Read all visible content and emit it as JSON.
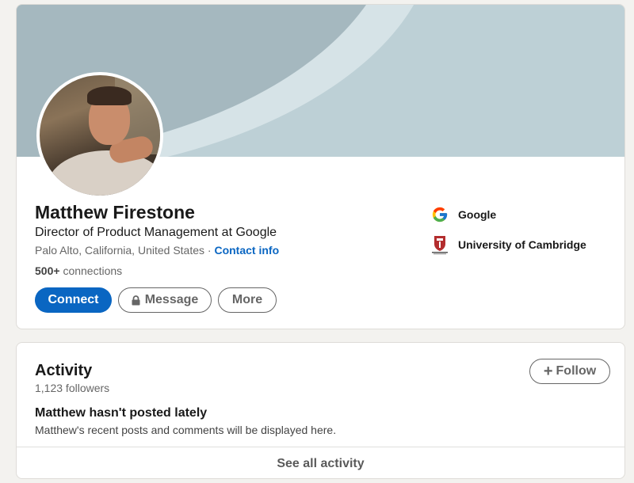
{
  "profile": {
    "name": "Matthew Firestone",
    "headline": "Director of Product Management at Google",
    "location": "Palo Alto, California, United States",
    "separator": "·",
    "contact_info": "Contact info",
    "connections_count": "500+",
    "connections_label": "connections",
    "actions": {
      "connect": "Connect",
      "message": "Message",
      "more": "More"
    },
    "organizations": [
      {
        "name": "Google",
        "icon": "google-logo-icon"
      },
      {
        "name": "University of Cambridge",
        "icon": "cambridge-crest-icon"
      }
    ]
  },
  "activity": {
    "title": "Activity",
    "followers": "1,123 followers",
    "follow_label": "Follow",
    "empty_title": "Matthew hasn't posted lately",
    "empty_desc": "Matthew's recent posts and comments will be displayed here.",
    "see_all": "See all activity"
  },
  "colors": {
    "primary": "#0a66c2",
    "banner": "#bdd0d6",
    "background": "#f3f2ef"
  }
}
